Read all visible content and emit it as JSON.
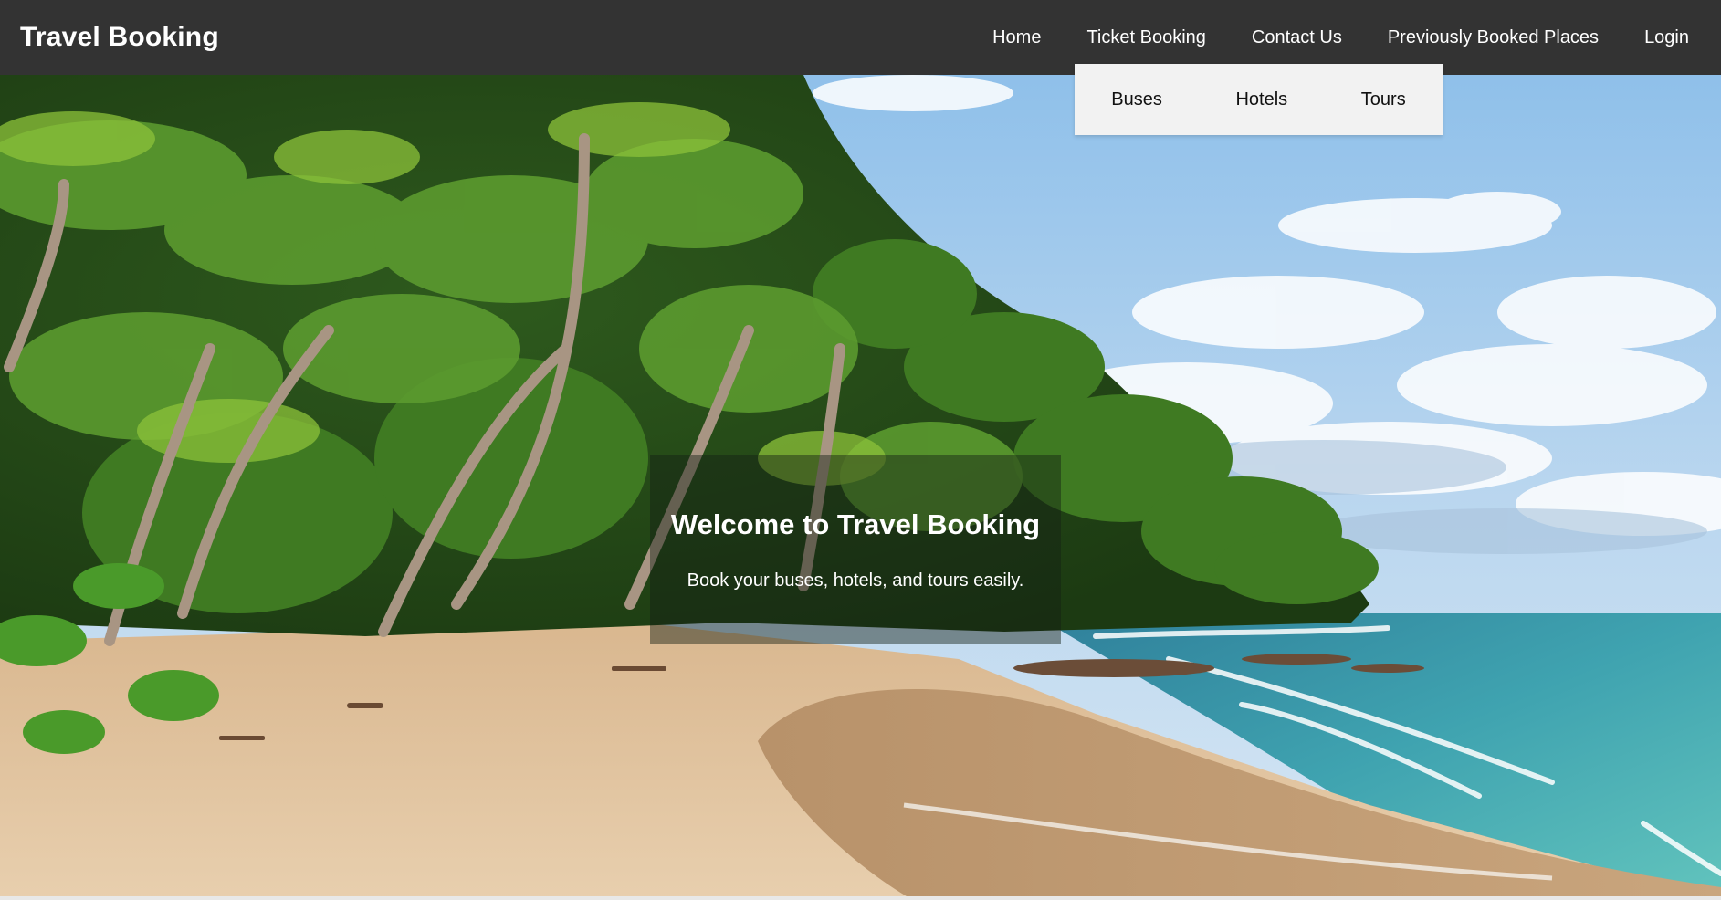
{
  "navbar": {
    "brand": "Travel Booking",
    "links": [
      "Home",
      "Ticket Booking",
      "Contact Us",
      "Previously Booked Places",
      "Login"
    ]
  },
  "dropdown": {
    "items": [
      "Buses",
      "Hotels",
      "Tours"
    ]
  },
  "hero": {
    "title": "Welcome to Travel Booking",
    "subtitle": "Book your buses, hotels, and tours easily."
  },
  "colors": {
    "navbar_bg": "#333333",
    "dropdown_bg": "#f2f2f2"
  }
}
